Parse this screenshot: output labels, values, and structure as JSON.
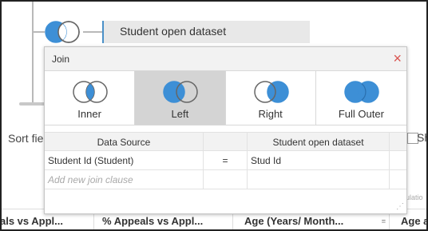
{
  "relation": {
    "name": "Student open dataset"
  },
  "sort": {
    "label": "Sort fie"
  },
  "show": {
    "label": "Sh"
  },
  "faint": {
    "text": "ulatio"
  },
  "columns": [
    {
      "label": "als vs Appl...",
      "sort": ""
    },
    {
      "label": "% Appeals vs Appl...",
      "sort": ""
    },
    {
      "label": "Age (Years/ Month...",
      "sort": "="
    },
    {
      "label": "Age at",
      "sort": ""
    }
  ],
  "dialog": {
    "title": "Join",
    "close_icon": "close-icon",
    "join_types": [
      {
        "label": "Inner",
        "selected": false,
        "icon": "inner-join-icon"
      },
      {
        "label": "Left",
        "selected": true,
        "icon": "left-join-icon"
      },
      {
        "label": "Right",
        "selected": false,
        "icon": "right-join-icon"
      },
      {
        "label": "Full Outer",
        "selected": false,
        "icon": "full-outer-join-icon"
      }
    ],
    "clause_header": {
      "left": "Data Source",
      "right": "Student open dataset"
    },
    "clauses": [
      {
        "left": "Student Id (Student)",
        "op": "=",
        "right": "Stud Id"
      }
    ],
    "add_placeholder": "Add new join clause"
  },
  "colors": {
    "join_blue": "#3d8fd6",
    "close_red": "#d9534f",
    "selected_bg": "#d4d4d4"
  }
}
